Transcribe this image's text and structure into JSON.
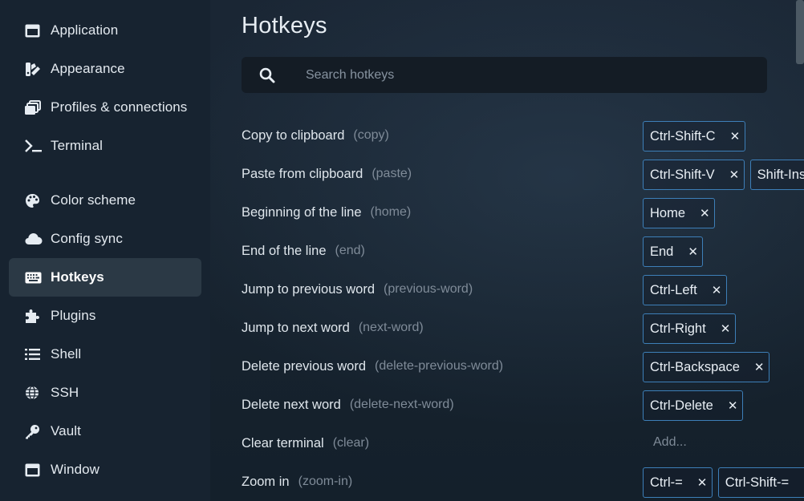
{
  "sidebar": {
    "items": [
      {
        "label": "Application",
        "icon": "window-icon"
      },
      {
        "label": "Appearance",
        "icon": "paint-swatches-icon"
      },
      {
        "label": "Profiles & connections",
        "icon": "stacked-windows-icon"
      },
      {
        "label": "Terminal",
        "icon": "terminal-prompt-icon"
      },
      {
        "label": "Color scheme",
        "icon": "palette-icon"
      },
      {
        "label": "Config sync",
        "icon": "cloud-icon"
      },
      {
        "label": "Hotkeys",
        "icon": "keyboard-icon",
        "active": true
      },
      {
        "label": "Plugins",
        "icon": "puzzle-icon"
      },
      {
        "label": "Shell",
        "icon": "list-icon"
      },
      {
        "label": "SSH",
        "icon": "globe-icon"
      },
      {
        "label": "Vault",
        "icon": "key-icon"
      },
      {
        "label": "Window",
        "icon": "window-icon"
      }
    ]
  },
  "main": {
    "title": "Hotkeys",
    "search": {
      "placeholder": "Search hotkeys",
      "value": ""
    },
    "add_label": "Add...",
    "hotkeys": [
      {
        "name": "Copy to clipboard",
        "id": "(copy)",
        "keys": [
          "Ctrl-Shift-C"
        ]
      },
      {
        "name": "Paste from clipboard",
        "id": "(paste)",
        "keys": [
          "Ctrl-Shift-V",
          "Shift-Insert"
        ]
      },
      {
        "name": "Beginning of the line",
        "id": "(home)",
        "keys": [
          "Home"
        ]
      },
      {
        "name": "End of the line",
        "id": "(end)",
        "keys": [
          "End"
        ]
      },
      {
        "name": "Jump to previous word",
        "id": "(previous-word)",
        "keys": [
          "Ctrl-Left"
        ]
      },
      {
        "name": "Jump to next word",
        "id": "(next-word)",
        "keys": [
          "Ctrl-Right"
        ]
      },
      {
        "name": "Delete previous word",
        "id": "(delete-previous-word)",
        "keys": [
          "Ctrl-Backspace"
        ]
      },
      {
        "name": "Delete next word",
        "id": "(delete-next-word)",
        "keys": [
          "Ctrl-Delete"
        ]
      },
      {
        "name": "Clear terminal",
        "id": "(clear)",
        "keys": []
      },
      {
        "name": "Zoom in",
        "id": "(zoom-in)",
        "keys": [
          "Ctrl-=",
          "Ctrl-Shift-="
        ]
      }
    ]
  },
  "colors": {
    "accent_border": "#3d7fb8",
    "active_nav": "#2b3945",
    "background": "#172330"
  }
}
